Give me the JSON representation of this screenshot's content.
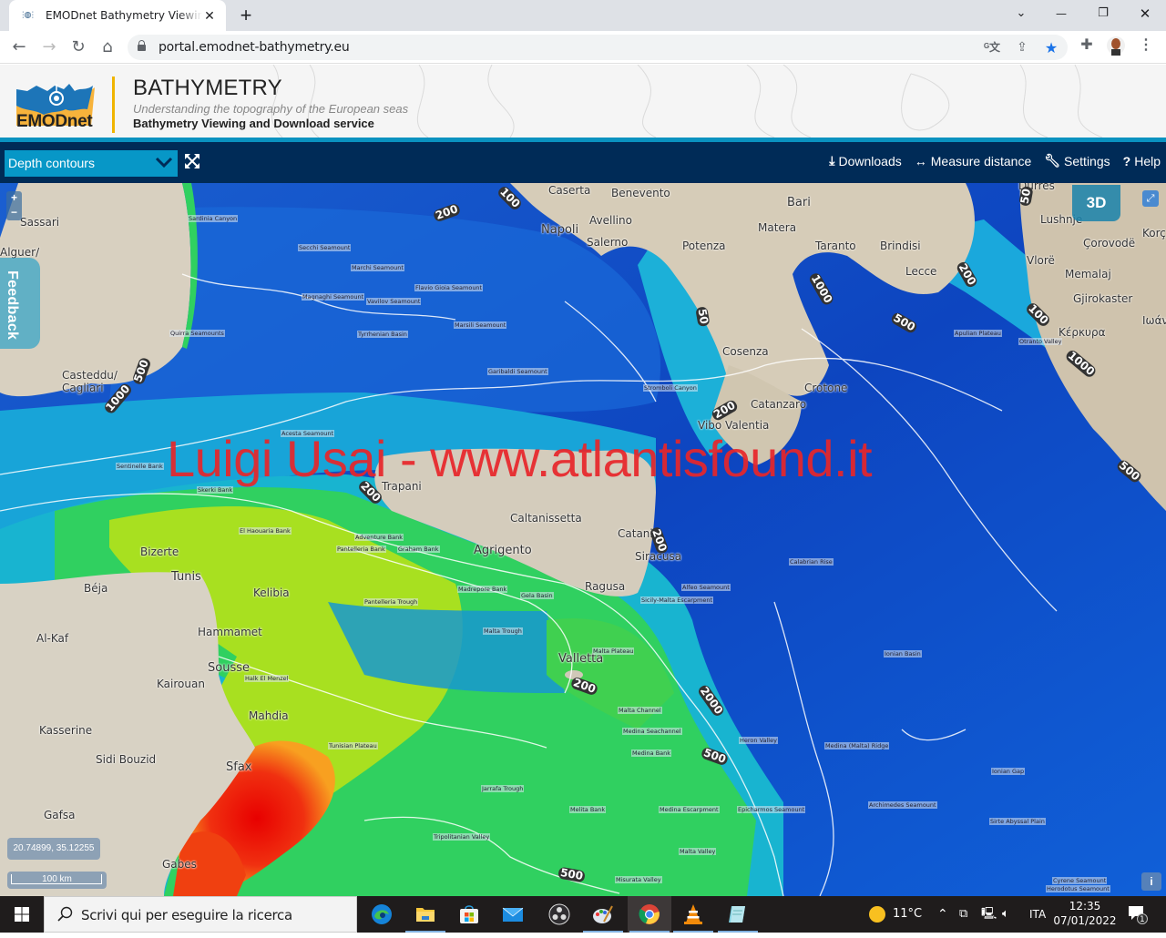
{
  "browser": {
    "tab_title": "EMODnet Bathymetry Viewing and Download service",
    "new_tab_label": "+",
    "url": "portal.emodnet-bathymetry.eu",
    "window_controls": {
      "tab_search": "⌄",
      "minimize": "—",
      "restore": "❐",
      "close": "✕"
    }
  },
  "header": {
    "logo_text": "EMODnet",
    "title": "BATHYMETRY",
    "tagline": "Understanding the topography of the European seas",
    "subtitle": "Bathymetry Viewing and Download service",
    "colors": {
      "accent_yellow": "#f0b400",
      "stripe": "#0a92c0",
      "navbar": "#002b57",
      "select": "#0797c7"
    }
  },
  "navbar": {
    "layer_select": {
      "selected": "Depth contours"
    },
    "items": [
      {
        "icon": "download-icon",
        "label": "Downloads"
      },
      {
        "icon": "arrows-horizontal-icon",
        "label": "Measure distance"
      },
      {
        "icon": "wrench-icon",
        "label": "Settings"
      },
      {
        "icon": "question-icon",
        "label": "Help"
      }
    ]
  },
  "map": {
    "zoom_in": "+",
    "zoom_out": "−",
    "feedback_label": "Feedback",
    "btn_3d": "3D",
    "expand": "⤢",
    "coordinates": "20.74899, 35.12255",
    "scale_label": "100 km",
    "info": "i",
    "watermark": "Luigi Usai - www.atlantisfound.it",
    "places": [
      {
        "name": "Caserta"
      },
      {
        "name": "Benevento"
      },
      {
        "name": "Bari"
      },
      {
        "name": "Avellino"
      },
      {
        "name": "Napoli"
      },
      {
        "name": "Matera"
      },
      {
        "name": "Salerno"
      },
      {
        "name": "Potenza"
      },
      {
        "name": "Taranto"
      },
      {
        "name": "Brindisi"
      },
      {
        "name": "Lecce"
      },
      {
        "name": "Lushnje"
      },
      {
        "name": "Çorovodë"
      },
      {
        "name": "Vlorë"
      },
      {
        "name": "Memalaj"
      },
      {
        "name": "Gjirokaster"
      },
      {
        "name": "Κέρκυρα"
      },
      {
        "name": "Ιωάν"
      },
      {
        "name": "Korç"
      },
      {
        "name": "Sassari"
      },
      {
        "name": "Alguer/"
      },
      {
        "name": "Casteddu/ Cagliari"
      },
      {
        "name": "Cosenza"
      },
      {
        "name": "Crotone"
      },
      {
        "name": "Catanzaro"
      },
      {
        "name": "Vibo Valentia"
      },
      {
        "name": "Trapani"
      },
      {
        "name": "Caltanissetta"
      },
      {
        "name": "Catania"
      },
      {
        "name": "Agrigento"
      },
      {
        "name": "Siracusa"
      },
      {
        "name": "Ragusa"
      },
      {
        "name": "Bizerte"
      },
      {
        "name": "Tunis"
      },
      {
        "name": "Béja"
      },
      {
        "name": "Kelibia"
      },
      {
        "name": "Hammamet"
      },
      {
        "name": "Al-Kaf"
      },
      {
        "name": "Sousse"
      },
      {
        "name": "Kairouan"
      },
      {
        "name": "Mahdia"
      },
      {
        "name": "Kasserine"
      },
      {
        "name": "Sidi Bouzid"
      },
      {
        "name": "Sfax"
      },
      {
        "name": "Gafsa"
      },
      {
        "name": "Gabes"
      },
      {
        "name": "Valletta"
      },
      {
        "name": "Durrës"
      }
    ],
    "features": [
      {
        "name": "Sardinia Canyon"
      },
      {
        "name": "Secchi Seamount"
      },
      {
        "name": "Marchi Seamount"
      },
      {
        "name": "Magnaghi Seamount"
      },
      {
        "name": "Flavio Gioia Seamount"
      },
      {
        "name": "Vavilov Seamount"
      },
      {
        "name": "Tyrrhenian Basin"
      },
      {
        "name": "Quirra Seamounts"
      },
      {
        "name": "Marsili Seamount"
      },
      {
        "name": "Garibaldi Seamount"
      },
      {
        "name": "Stromboli Canyon"
      },
      {
        "name": "Acesta Seamount"
      },
      {
        "name": "Sentinelle Bank"
      },
      {
        "name": "Skerki Bank"
      },
      {
        "name": "Adventure Bank"
      },
      {
        "name": "Pantelleria Bank"
      },
      {
        "name": "Graham Bank"
      },
      {
        "name": "Pantelleria Trough"
      },
      {
        "name": "Madrepore Bank"
      },
      {
        "name": "Gela Basin"
      },
      {
        "name": "Malta Trough"
      },
      {
        "name": "Malta Plateau"
      },
      {
        "name": "Malta Channel"
      },
      {
        "name": "Medina Seachannel"
      },
      {
        "name": "Medina Bank"
      },
      {
        "name": "Melita Bank"
      },
      {
        "name": "Medina Escarpment"
      },
      {
        "name": "Malta Valley"
      },
      {
        "name": "Misurata Valley"
      },
      {
        "name": "Heron Valley"
      },
      {
        "name": "Medina (Malta) Ridge"
      },
      {
        "name": "Epicharmos Seamount"
      },
      {
        "name": "Archimedes Seamount"
      },
      {
        "name": "Calabrian Rise"
      },
      {
        "name": "Ionian Basin"
      },
      {
        "name": "Ionian Gap"
      },
      {
        "name": "Sirte Abyssal Plain"
      },
      {
        "name": "Alfeo Seamount"
      },
      {
        "name": "Sicily-Malta Escarpment"
      },
      {
        "name": "Apulian Plateau"
      },
      {
        "name": "Otranto Valley"
      },
      {
        "name": "Tunisian Plateau"
      },
      {
        "name": "Jarrafa Trough"
      },
      {
        "name": "Tripolitanian Valley"
      },
      {
        "name": "El Haouaria Bank"
      },
      {
        "name": "Herodotus Seamount"
      },
      {
        "name": "Cyrene Seamount"
      },
      {
        "name": "Halk El Menzel"
      }
    ],
    "contour_labels": [
      "100",
      "200",
      "1000",
      "500",
      "50",
      "200",
      "100",
      "500",
      "1000",
      "500",
      "1000",
      "200",
      "200",
      "200",
      "2000",
      "500",
      "500",
      "200",
      "50"
    ]
  },
  "taskbar": {
    "search_placeholder": "Scrivi qui per eseguire la ricerca",
    "apps": [
      "Microsoft Edge",
      "File Explorer",
      "Microsoft Store",
      "Mail",
      "OBS Studio",
      "Paint",
      "Google Chrome",
      "VLC",
      "Notepad"
    ],
    "weather": "11°C",
    "language": "ITA",
    "time": "12:35",
    "date": "07/01/2022",
    "notifications": "1"
  }
}
